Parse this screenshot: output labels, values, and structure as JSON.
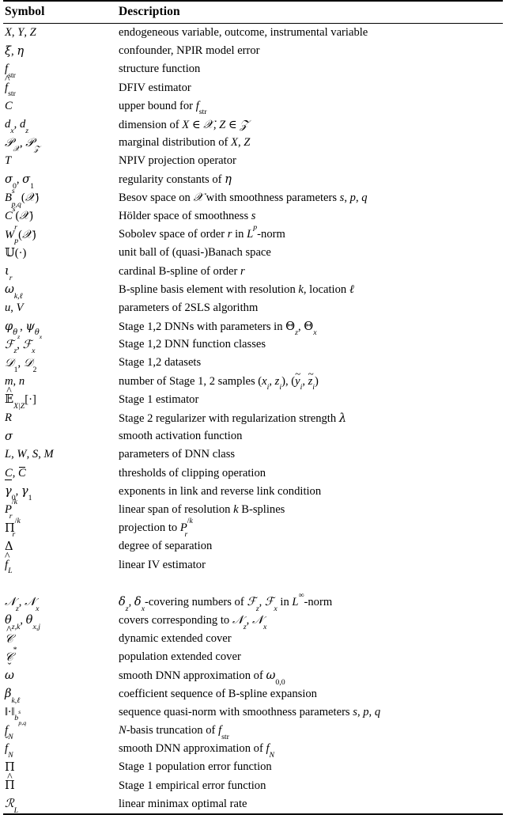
{
  "table": {
    "headers": {
      "symbol": "Symbol",
      "description": "Description"
    },
    "rows": [
      {
        "symbol": "X, Y, Z",
        "description": "endogeneous variable, outcome, instrumental variable"
      },
      {
        "symbol": "ξ, η",
        "description": "confounder, NPIR model error"
      },
      {
        "symbol": "f_str",
        "description": "structure function"
      },
      {
        "symbol": "f̂_str",
        "description": "DFIV estimator"
      },
      {
        "symbol": "C",
        "description": "upper bound for f_str"
      },
      {
        "symbol": "d_x, d_z",
        "description": "dimension of X ∈ 𝒳, Z ∈ 𝒵"
      },
      {
        "symbol": "𝒫_𝒳, 𝒫_𝒵",
        "description": "marginal distribution of X, Z"
      },
      {
        "symbol": "T",
        "description": "NPIV projection operator"
      },
      {
        "symbol": "σ_0, σ_1",
        "description": "regularity constants of η"
      },
      {
        "symbol": "B^s_{p,q}(𝒳)",
        "description": "Besov space on 𝒳 with smoothness parameters s, p, q"
      },
      {
        "symbol": "C^s(𝒳)",
        "description": "Hölder space of smoothness s"
      },
      {
        "symbol": "W^r_p(𝒳)",
        "description": "Sobolev space of order r in L^p-norm"
      },
      {
        "symbol": "𝕌(·)",
        "description": "unit ball of (quasi-)Banach space"
      },
      {
        "symbol": "ι_r",
        "description": "cardinal B-spline of order r"
      },
      {
        "symbol": "ω_{k,ℓ}",
        "description": "B-spline basis element with resolution k, location ℓ"
      },
      {
        "symbol": "u, V",
        "description": "parameters of 2SLS algorithm"
      },
      {
        "symbol": "φ_{θ_z}, ψ_{θ_x}",
        "description": "Stage 1,2 DNNs with parameters in Θ_z, Θ_x"
      },
      {
        "symbol": "ℱ_z, ℱ_x",
        "description": "Stage 1,2 DNN function classes"
      },
      {
        "symbol": "𝒟_1, 𝒟_2",
        "description": "Stage 1,2 datasets"
      },
      {
        "symbol": "m, n",
        "description": "number of Stage 1, 2 samples (x_i, z_i), (ỹ_i, z̃_i)"
      },
      {
        "symbol": "Ê_{X|Z}[·]",
        "description": "Stage 1 estimator"
      },
      {
        "symbol": "R",
        "description": "Stage 2 regularizer with regularization strength λ"
      },
      {
        "symbol": "σ",
        "description": "smooth activation function"
      },
      {
        "symbol": "L, W, S, M",
        "description": "parameters of DNN class"
      },
      {
        "symbol": "C̲, C̄",
        "description": "thresholds of clipping operation"
      },
      {
        "symbol": "γ_0, γ_1",
        "description": "exponents in link and reverse link condition"
      },
      {
        "symbol": "P_r^{/k}",
        "description": "linear span of resolution k B-splines"
      },
      {
        "symbol": "Π_r^{/k}",
        "description": "projection to P_r^{/k}"
      },
      {
        "symbol": "Δ",
        "description": "degree of separation"
      },
      {
        "symbol": "f̂_L",
        "description": "linear IV estimator"
      },
      {
        "symbol": "",
        "description": ""
      },
      {
        "symbol": "𝒩_z, 𝒩_x",
        "description": "δ_z, δ_x-covering numbers of ℱ_z, ℱ_x in L^∞-norm"
      },
      {
        "symbol": "θ_{z,k}, θ_{x,j}",
        "description": "covers corresponding to 𝒩_z, 𝒩_x"
      },
      {
        "symbol": "𝒞̂",
        "description": "dynamic extended cover"
      },
      {
        "symbol": "𝒞*",
        "description": "population extended cover"
      },
      {
        "symbol": "ω̌",
        "description": "smooth DNN approximation of ω_{0,0}"
      },
      {
        "symbol": "β_{k,ℓ}",
        "description": "coefficient sequence of B-spline expansion"
      },
      {
        "symbol": "‖·‖_{b^s_{p,q}}",
        "description": "sequence quasi-norm with smoothness parameters s, p, q"
      },
      {
        "symbol": "f_N",
        "description": "N-basis truncation of f_str"
      },
      {
        "symbol": "f̌_N",
        "description": "smooth DNN approximation of f_N"
      },
      {
        "symbol": "Π",
        "description": "Stage 1 population error function"
      },
      {
        "symbol": "Π̂",
        "description": "Stage 1 empirical error function"
      },
      {
        "symbol": "ℛ_L",
        "description": "linear minimax optimal rate"
      }
    ]
  }
}
